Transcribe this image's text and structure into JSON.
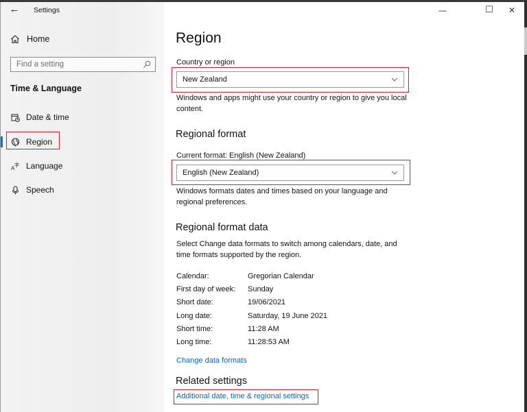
{
  "window": {
    "title": "Settings",
    "controls": {
      "minimize": "—",
      "maximize": "☐",
      "close": "✕"
    }
  },
  "sidebar": {
    "home_label": "Home",
    "search_placeholder": "Find a setting",
    "section_title": "Time & Language",
    "items": [
      {
        "label": "Date & time",
        "icon": "calendar-clock-icon",
        "selected": false
      },
      {
        "label": "Region",
        "icon": "globe-icon",
        "selected": true
      },
      {
        "label": "Language",
        "icon": "language-icon",
        "selected": false
      },
      {
        "label": "Speech",
        "icon": "microphone-icon",
        "selected": false
      }
    ]
  },
  "main": {
    "title": "Region",
    "country": {
      "label": "Country or region",
      "value": "New Zealand",
      "description": "Windows and apps might use your country or region to give you local content."
    },
    "regional_format": {
      "heading": "Regional format",
      "current_label": "Current format: English (New Zealand)",
      "value": "English (New Zealand)",
      "description": "Windows formats dates and times based on your language and regional preferences."
    },
    "format_data": {
      "heading": "Regional format data",
      "description": "Select Change data formats to switch among calendars, date, and time formats supported by the region.",
      "rows": [
        {
          "key": "Calendar:",
          "value": "Gregorian Calendar"
        },
        {
          "key": "First day of week:",
          "value": "Sunday"
        },
        {
          "key": "Short date:",
          "value": "19/06/2021"
        },
        {
          "key": "Long date:",
          "value": "Saturday, 19 June 2021"
        },
        {
          "key": "Short time:",
          "value": "11:28 AM"
        },
        {
          "key": "Long time:",
          "value": "11:28:53 AM"
        }
      ],
      "change_link": "Change data formats"
    },
    "related": {
      "heading": "Related settings",
      "link": "Additional date, time & regional settings"
    }
  },
  "colors": {
    "accent": "#0078d7",
    "link": "#0067c0",
    "highlight_box": "#e0192a"
  }
}
